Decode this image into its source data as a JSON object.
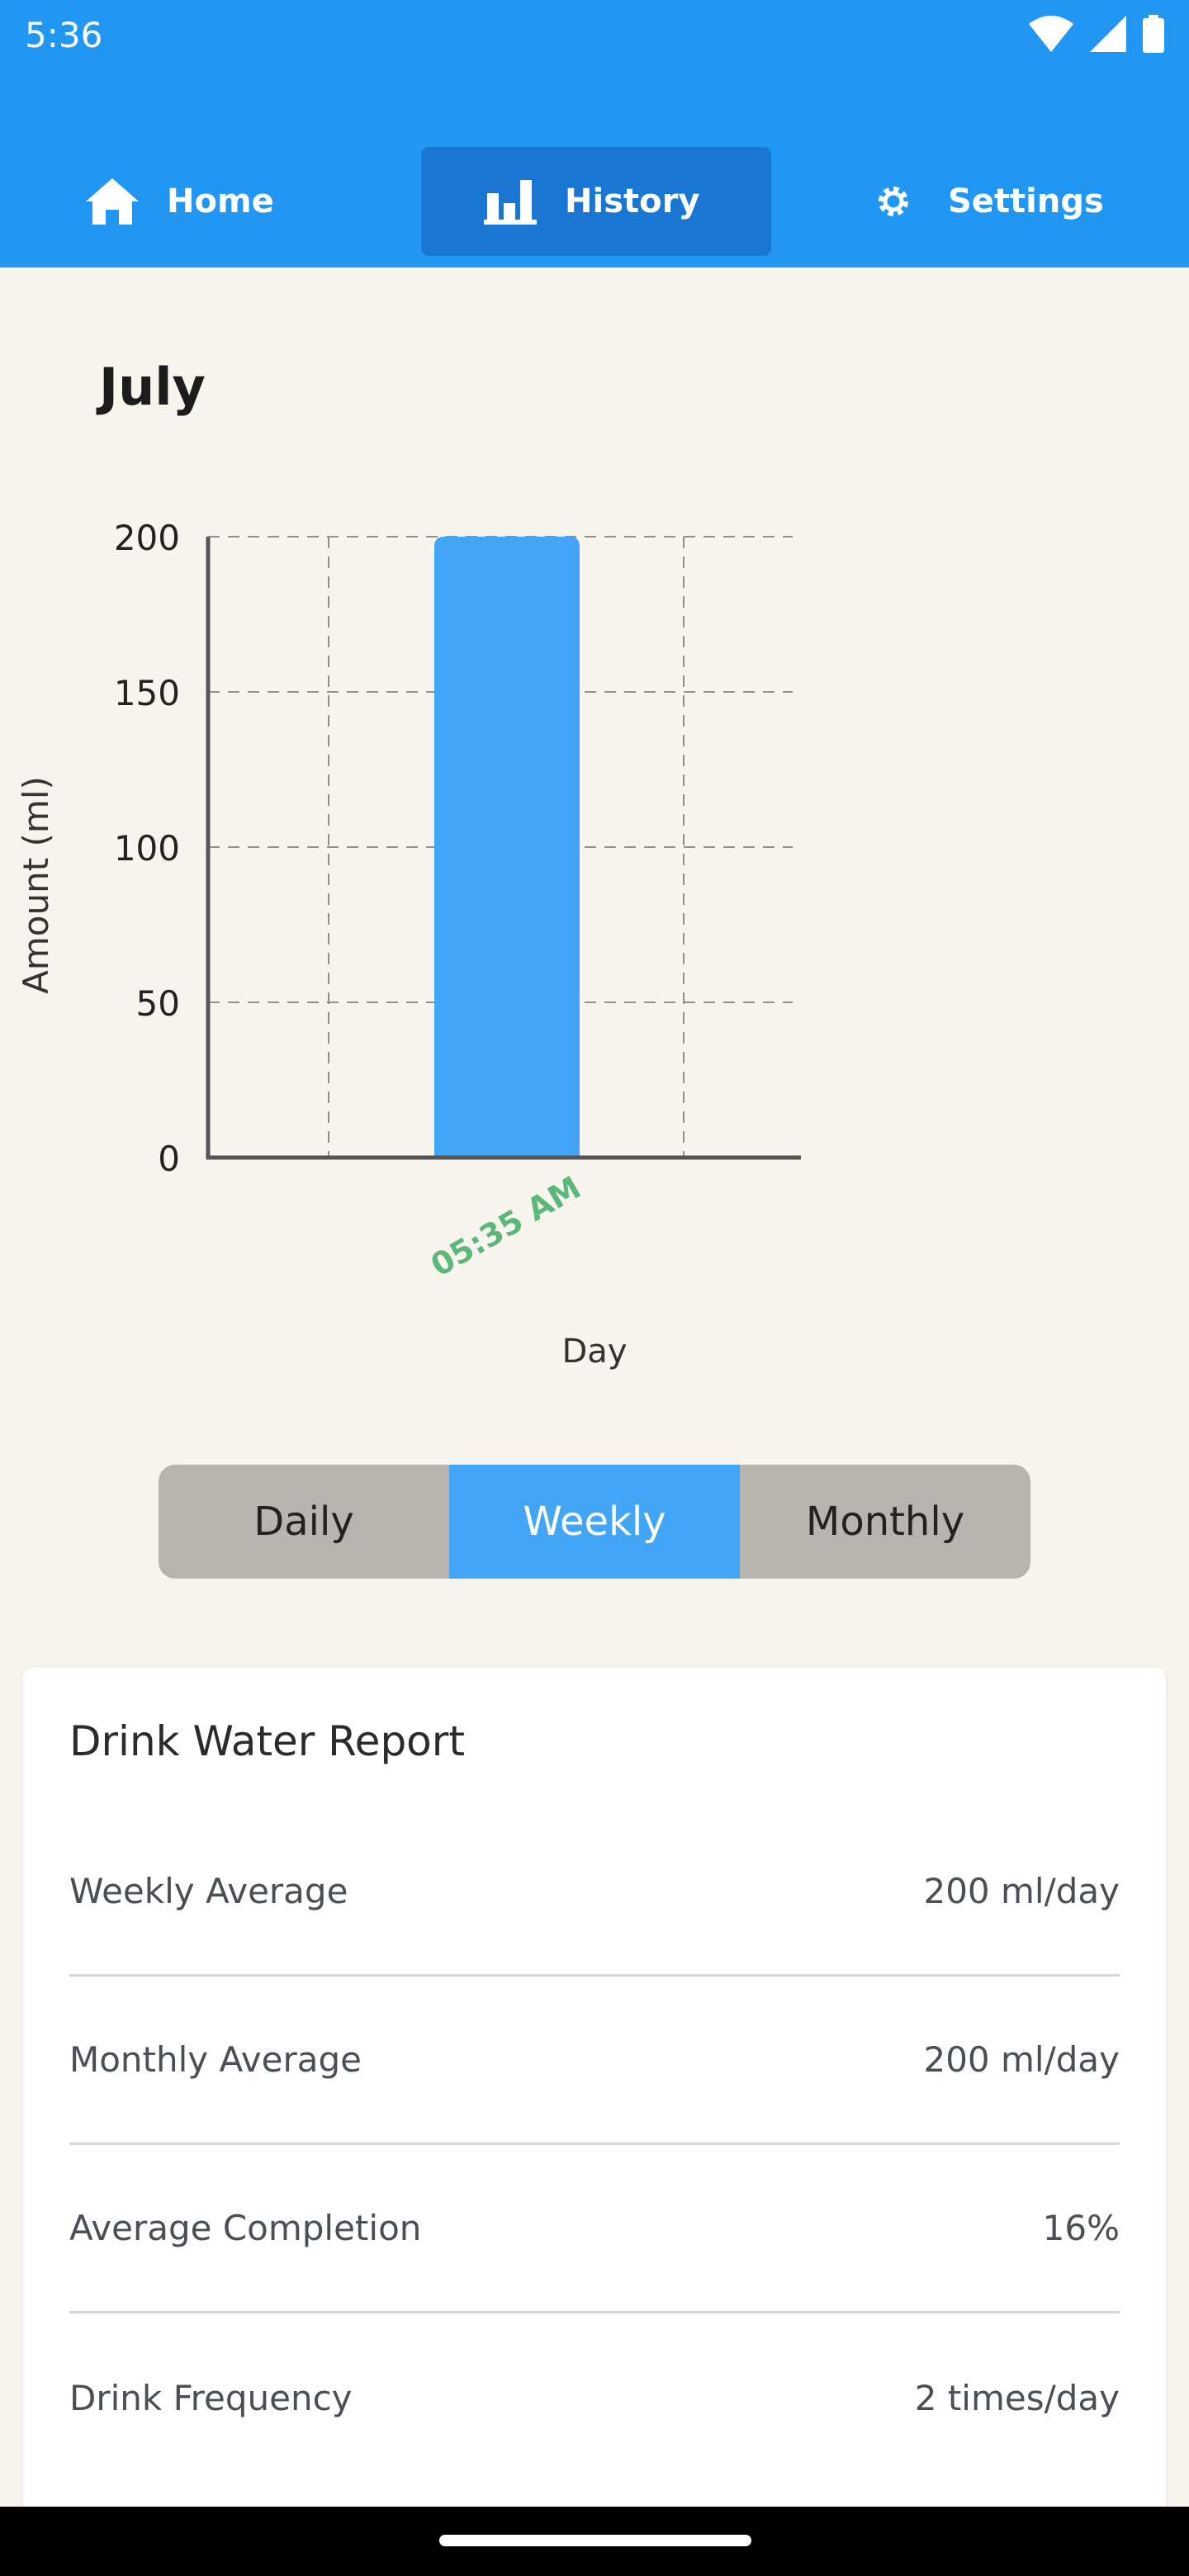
{
  "status": {
    "time": "5:36"
  },
  "tabs": [
    {
      "label": "Home",
      "icon": "home-icon"
    },
    {
      "label": "History",
      "icon": "bar-chart-icon",
      "active": true
    },
    {
      "label": "Settings",
      "icon": "gear-icon"
    }
  ],
  "month": "July",
  "chart_data": {
    "type": "bar",
    "categories": [
      "05:35 AM"
    ],
    "values": [
      200
    ],
    "xlabel": "Day",
    "ylabel": "Amount (ml)",
    "ylim": [
      0,
      200
    ],
    "yticks": [
      0,
      50,
      100,
      150,
      200
    ],
    "grid": true,
    "bar_color": "#42a5f5",
    "category_label_color": "#5cb87a"
  },
  "periods": [
    {
      "label": "Daily"
    },
    {
      "label": "Weekly",
      "active": true
    },
    {
      "label": "Monthly"
    }
  ],
  "report": {
    "title": "Drink Water Report",
    "rows": [
      {
        "label": "Weekly Average",
        "value": "200 ml/day"
      },
      {
        "label": "Monthly Average",
        "value": "200 ml/day"
      },
      {
        "label": "Average Completion",
        "value": "16%"
      },
      {
        "label": "Drink Frequency",
        "value": "2 times/day"
      }
    ]
  },
  "colors": {
    "primary": "#2196f3",
    "primary_dark": "#1976d2",
    "background": "#f8f5ef"
  }
}
